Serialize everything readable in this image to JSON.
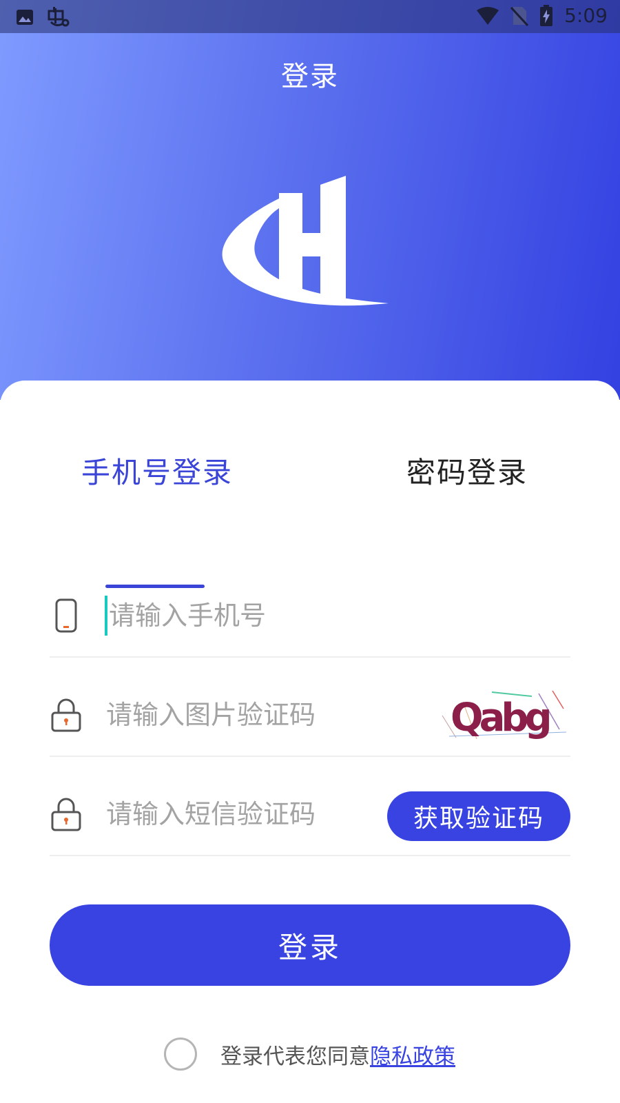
{
  "status_bar": {
    "time": "5:09",
    "left_icons": [
      "image-icon",
      "bug-icon"
    ],
    "right_icons": [
      "wifi-icon",
      "no-sim-icon",
      "battery-charging-icon"
    ]
  },
  "header": {
    "title": "登录",
    "logo_icon": "brand-h-logo"
  },
  "tabs": [
    {
      "label": "手机号登录",
      "active": true
    },
    {
      "label": "密码登录",
      "active": false
    }
  ],
  "form": {
    "phone": {
      "placeholder": "请输入手机号",
      "value": "",
      "icon": "phone-icon"
    },
    "captcha": {
      "placeholder": "请输入图片验证码",
      "value": "",
      "icon": "lock-icon",
      "captcha_text": "Qabg"
    },
    "sms": {
      "placeholder": "请输入短信验证码",
      "value": "",
      "icon": "lock-icon",
      "button_label": "获取验证码"
    }
  },
  "login_button": {
    "label": "登录"
  },
  "agreement": {
    "text": "登录代表您同意",
    "link_label": "隐私政策",
    "checked": false
  },
  "colors": {
    "primary": "#3843E2",
    "gradient_start": "#7F9BFF",
    "gradient_end": "#3341E1",
    "cursor": "#18C9C0",
    "placeholder": "#A3A3A3"
  }
}
